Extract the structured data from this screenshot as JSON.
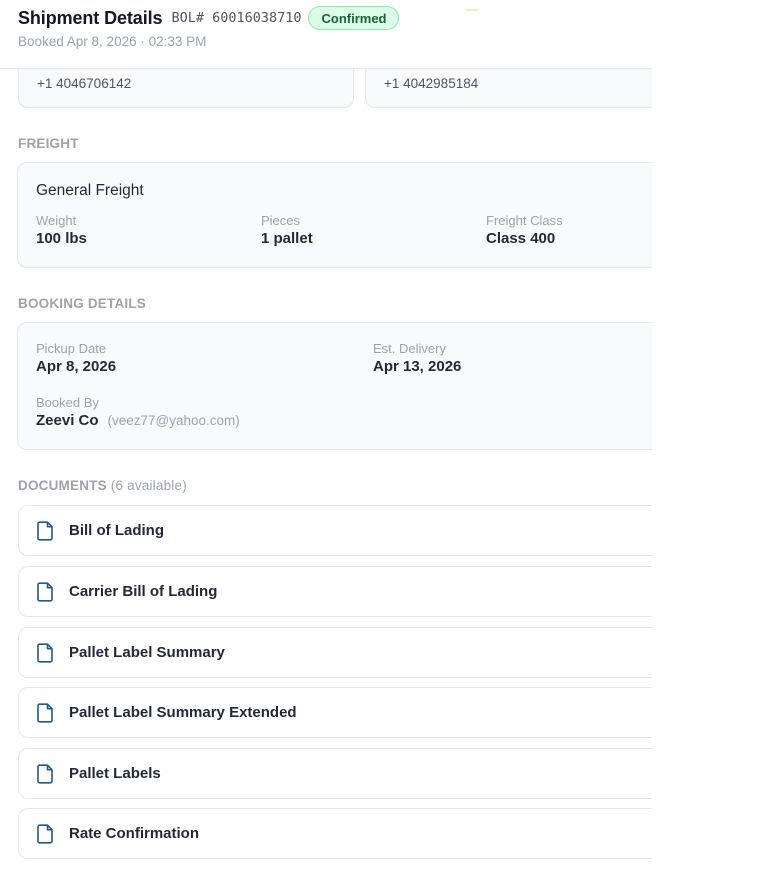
{
  "header": {
    "title": "Shipment Details",
    "bol": "BOL# 60016038710",
    "status": "Confirmed",
    "booked_at": "Booked Apr 8, 2026 · 02:33 PM"
  },
  "contacts": [
    {
      "phone": "+1 4046706142"
    },
    {
      "phone": "+1 4042985184"
    }
  ],
  "freight": {
    "section_label": "FREIGHT",
    "type": "General Freight",
    "weight_label": "Weight",
    "weight": "100 lbs",
    "pieces_label": "Pieces",
    "pieces": "1 pallet",
    "class_label": "Freight Class",
    "class": "Class 400"
  },
  "booking": {
    "section_label": "BOOKING DETAILS",
    "pickup_label": "Pickup Date",
    "pickup": "Apr 8, 2026",
    "delivery_label": "Est. Delivery",
    "delivery": "Apr 13, 2026",
    "booked_by_label": "Booked By",
    "booked_by_name": "Zeevi Co",
    "booked_by_email": "(veez77@yahoo.com)"
  },
  "documents": {
    "section_label": "DOCUMENTS",
    "count": "(6 available)",
    "items": [
      {
        "name": "Bill of Lading",
        "icon": "document-icon"
      },
      {
        "name": "Carrier Bill of Lading",
        "icon": "document-icon"
      },
      {
        "name": "Pallet Label Summary",
        "icon": "document-icon"
      },
      {
        "name": "Pallet Label Summary Extended",
        "icon": "document-icon"
      },
      {
        "name": "Pallet Labels",
        "icon": "document-icon"
      },
      {
        "name": "Rate Confirmation",
        "icon": "document-icon"
      }
    ]
  },
  "colors": {
    "badge_bg": "#dcfce7",
    "badge_text": "#166534",
    "doc_icon": "#1e5a8a",
    "muted": "#9ca3af"
  }
}
